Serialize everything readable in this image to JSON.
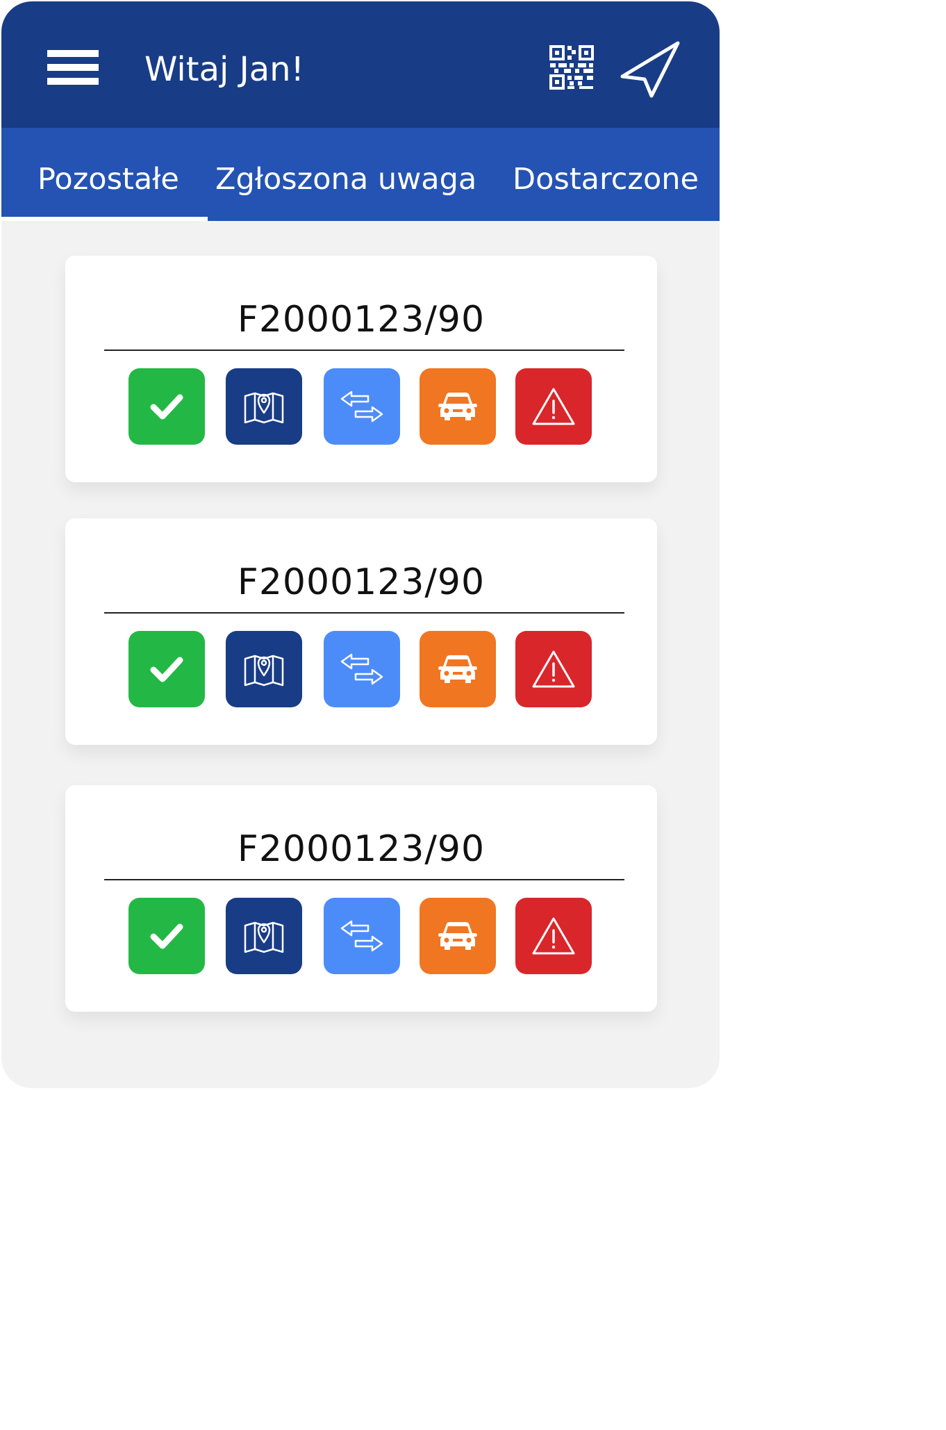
{
  "header": {
    "greeting": "Witaj Jan!",
    "menu_icon": "hamburger-menu-icon",
    "qr_icon": "qr-code-icon",
    "navigation_icon": "navigation-arrow-icon",
    "background_color": "#193c86"
  },
  "tabs": [
    {
      "label": "Pozostałe",
      "active": true
    },
    {
      "label": "Zgłoszona uwaga",
      "active": false
    },
    {
      "label": "Dostarczone",
      "active": false
    }
  ],
  "tabbar_color": "#2453b3",
  "cards": [
    {
      "number": "F2000123/90"
    },
    {
      "number": "F2000123/90"
    },
    {
      "number": "F2000123/90"
    }
  ],
  "actions": [
    {
      "icon": "checkmark-icon",
      "color": "#23b845"
    },
    {
      "icon": "map-pin-icon",
      "color": "#193c86"
    },
    {
      "icon": "swap-arrows-icon",
      "color": "#4c8cf8"
    },
    {
      "icon": "car-icon",
      "color": "#f07622"
    },
    {
      "icon": "warning-triangle-icon",
      "color": "#d9262b"
    }
  ]
}
